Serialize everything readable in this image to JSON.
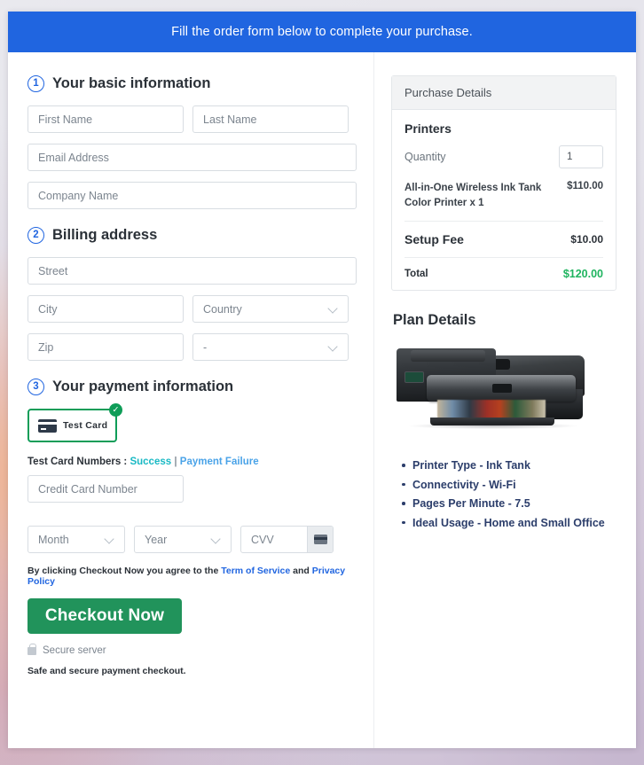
{
  "header": {
    "banner_text": "Fill the order form below to complete your purchase.",
    "banner_color": "#2065e0"
  },
  "form": {
    "sections": [
      {
        "number": "1",
        "title": "Your basic information"
      },
      {
        "number": "2",
        "title": "Billing address"
      },
      {
        "number": "3",
        "title": "Your payment information"
      }
    ],
    "basic": {
      "first_name_placeholder": "First Name",
      "last_name_placeholder": "Last Name",
      "email_placeholder": "Email Address",
      "company_placeholder": "Company Name"
    },
    "billing": {
      "street_placeholder": "Street",
      "city_placeholder": "City",
      "country_placeholder": "Country",
      "zip_placeholder": "Zip",
      "state_placeholder": "-"
    },
    "payment": {
      "card_tile_label": "Test Card",
      "card_tile_selected": true,
      "card_tile_border_color": "#0f9d58",
      "check_badge_glyph": "✓",
      "test_numbers_label": "Test Card Numbers :",
      "link_success": "Success",
      "pipe": "|",
      "link_failure": "Payment Failure",
      "card_number_placeholder": "Credit Card Number",
      "month_placeholder": "Month",
      "year_placeholder": "Year",
      "cvv_placeholder": "CVV"
    },
    "terms": {
      "prefix": "By clicking Checkout Now you agree to the",
      "tos_link": "Term of Service",
      "conjunction": "and",
      "privacy_link": "Privacy Policy"
    },
    "checkout_button": "Checkout Now",
    "checkout_button_color": "#21935b",
    "secure_server_label": "Secure server",
    "safe_note": "Safe and secure payment checkout."
  },
  "purchase_details": {
    "panel_title": "Purchase Details",
    "product_group": "Printers",
    "quantity_label": "Quantity",
    "quantity_value": "1",
    "line_item": {
      "description": "All-in-One Wireless Ink Tank Color Printer x 1",
      "amount": "$110.00"
    },
    "setup_fee": {
      "label": "Setup Fee",
      "amount": "$10.00"
    },
    "total": {
      "label": "Total",
      "amount": "$120.00",
      "color": "#1fb45f"
    }
  },
  "plan_details": {
    "title": "Plan Details",
    "bullets": [
      "Printer Type - Ink Tank",
      "Connectivity - Wi-Fi",
      "Pages Per Minute - 7.5",
      "Ideal Usage - Home and Small Office"
    ],
    "bullet_color": "#2c3e6b"
  }
}
